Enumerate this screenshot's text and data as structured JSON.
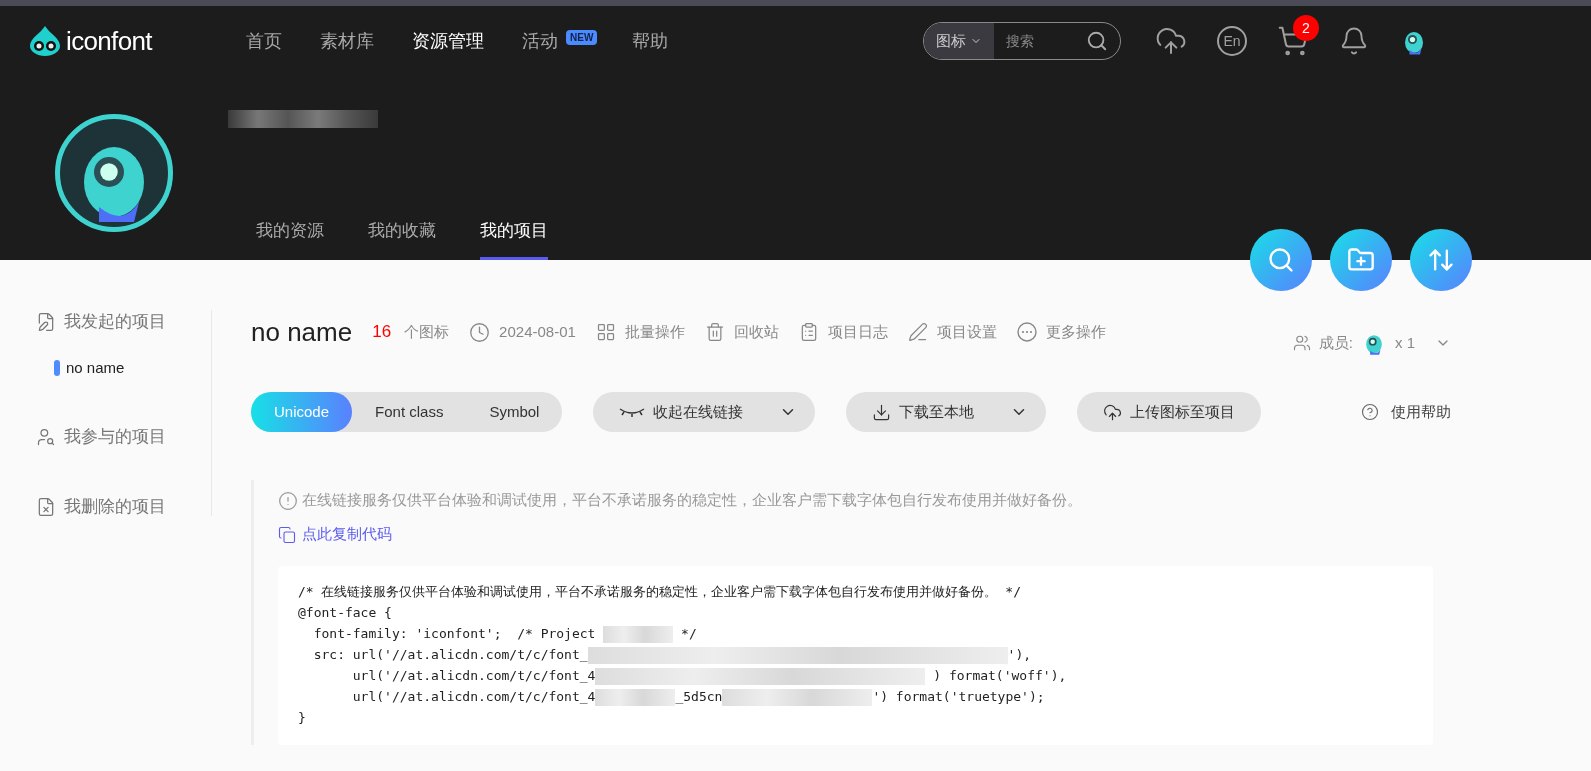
{
  "nav": {
    "logo": "iconfont",
    "items": [
      {
        "label": "首页",
        "selected": false
      },
      {
        "label": "素材库",
        "selected": false
      },
      {
        "label": "资源管理",
        "selected": true
      },
      {
        "label": "活动",
        "selected": false,
        "badge": "NEW"
      },
      {
        "label": "帮助",
        "selected": false
      }
    ],
    "search": {
      "scope": "图标",
      "placeholder": "搜索"
    },
    "language": "En",
    "cart_count": "2"
  },
  "profile_tabs": [
    {
      "label": "我的资源",
      "selected": false
    },
    {
      "label": "我的收藏",
      "selected": false
    },
    {
      "label": "我的项目",
      "selected": true
    }
  ],
  "sidebar": [
    {
      "kind": "group",
      "label": "我发起的项目"
    },
    {
      "kind": "project",
      "label": "no name",
      "color": "#4f8cff"
    },
    {
      "kind": "group",
      "label": "我参与的项目"
    },
    {
      "kind": "group",
      "label": "我删除的项目"
    }
  ],
  "project": {
    "name": "no name",
    "count": "16",
    "count_label": "个图标",
    "date": "2024-08-01",
    "actions": [
      {
        "label": "批量操作"
      },
      {
        "label": "回收站"
      },
      {
        "label": "项目日志"
      },
      {
        "label": "项目设置"
      },
      {
        "label": "更多操作"
      }
    ],
    "members_label": "成员:",
    "members_count": "x 1"
  },
  "format_tabs": [
    {
      "label": "Unicode",
      "selected": true
    },
    {
      "label": "Font class",
      "selected": false
    },
    {
      "label": "Symbol",
      "selected": false
    }
  ],
  "buttons": [
    {
      "label": "收起在线链接",
      "dropdown": true
    },
    {
      "label": "下载至本地",
      "dropdown": true
    },
    {
      "label": "上传图标至项目",
      "dropdown": false
    }
  ],
  "help": "使用帮助",
  "notice": "在线链接服务仅供平台体验和调试使用，平台不承诺服务的稳定性，企业客户需下载字体包自行发布使用并做好备份。",
  "copy_link": "点此复制代码",
  "code_lines": [
    [
      {
        "text": "/* 在线链接服务仅供平台体验和调试使用，平台不承诺服务的稳定性，企业客户需下载字体包自行发布使用并做好备份。 */"
      }
    ],
    [
      {
        "text": "@font-face {"
      }
    ],
    [
      {
        "text": "  font-family: 'iconfont';  /* Project "
      },
      {
        "kind": "redacted"
      },
      {
        "text": " */"
      }
    ],
    [
      {
        "text": "  src: url('//at.alicdn.com/t/c/font_"
      },
      {
        "kind": "redacted"
      },
      {
        "text": "'),"
      }
    ],
    [
      {
        "text": "       url('//at.alicdn.com/t/c/font_4"
      },
      {
        "kind": "redacted"
      },
      {
        "text": " ) format('woff'),"
      }
    ],
    [
      {
        "text": "       url('//at.alicdn.com/t/c/font_4"
      },
      {
        "kind": "redacted"
      },
      {
        "text": "_5d5cn"
      },
      {
        "kind": "redacted"
      },
      {
        "text": "') format('truetype');"
      }
    ],
    [
      {
        "text": "}"
      }
    ]
  ]
}
